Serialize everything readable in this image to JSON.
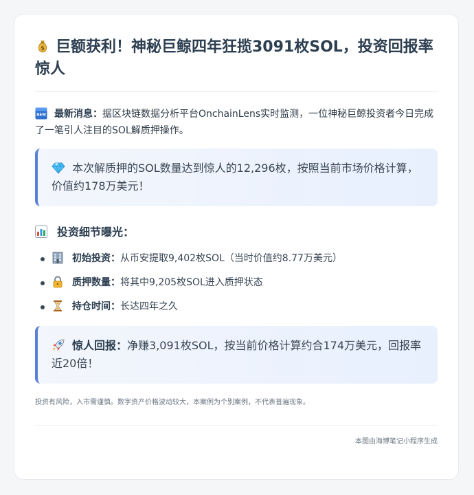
{
  "article": {
    "title_icon": "money-bag-icon",
    "title": "巨额获利！神秘巨鲸四年狂揽3091枚SOL，投资回报率惊人",
    "news": {
      "icon": "new-badge-icon",
      "label": "最新消息：",
      "text": "据区块链数据分析平台OnchainLens实时监测，一位神秘巨鲸投资者今日完成了一笔引人注目的SOL解质押操作。"
    },
    "highlight": {
      "icon": "gem-icon",
      "text": "本次解质押的SOL数量达到惊人的12,296枚，按照当前市场价格计算，价值约178万美元！"
    },
    "section": {
      "icon": "bar-chart-icon",
      "heading": "投资细节曝光："
    },
    "details": [
      {
        "icon": "bank-building-icon",
        "label": "初始投资：",
        "text": "从币安提取9,402枚SOL（当时价值约8.77万美元）"
      },
      {
        "icon": "lock-icon",
        "label": "质押数量：",
        "text": "将其中9,205枚SOL进入质押状态"
      },
      {
        "icon": "hourglass-icon",
        "label": "持仓时间：",
        "text": "长达四年之久"
      }
    ],
    "return_box": {
      "icon": "rocket-icon",
      "label": "惊人回报：",
      "text": "净赚3,091枚SOL，按当前价格计算约合174万美元，回报率近20倍！"
    },
    "disclaimer": "投资有风险，入市需谨慎。数字资产价格波动较大，本案例为个别案例，不代表普遍现象。",
    "footer": "本图由海博笔记小程序生成"
  },
  "colors": {
    "accent": "#5b7fd6",
    "callout_bg_start": "#f3f6fc",
    "callout_bg_end": "#e8f0fe",
    "heading_text": "#2c3e50",
    "muted_text": "#6b7682"
  }
}
